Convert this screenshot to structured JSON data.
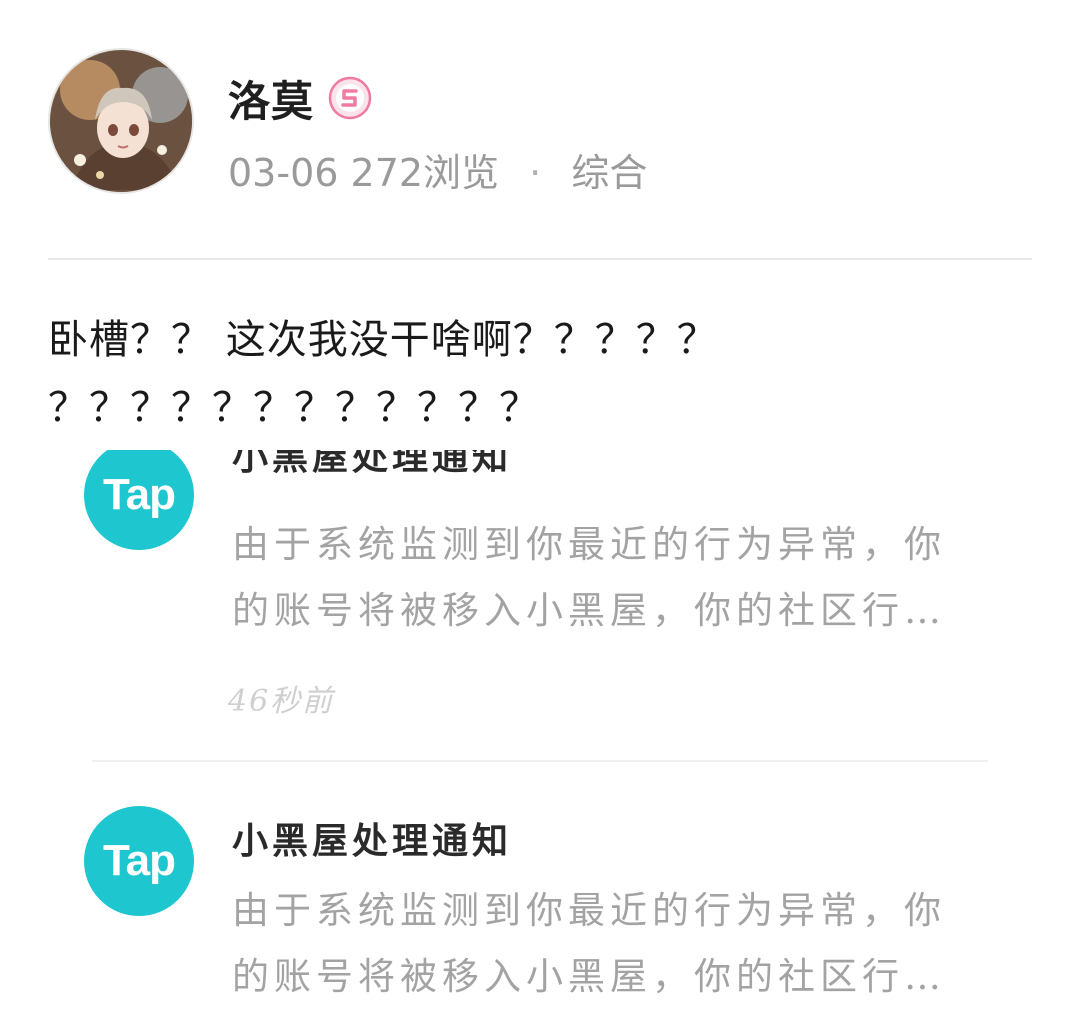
{
  "post": {
    "author": "洛莫",
    "date": "03-06",
    "views": "272浏览",
    "separator": "·",
    "category": "综合",
    "body_line1": "卧槽？？ 这次我没干啥啊？？？？？",
    "body_line2": "？？？？？？？？？？？？"
  },
  "notifications": [
    {
      "logo": "Tap",
      "title": "小黑屋处理通知",
      "line1": "由于系统监测到你最近的行为异常，你",
      "line2": "的账号将被移入小黑屋，你的社区行…",
      "time": "46秒前"
    },
    {
      "logo": "Tap",
      "title": "小黑屋处理通知",
      "line1": "由于系统监测到你最近的行为异常，你",
      "line2": "的账号将被移入小黑屋，你的社区行…"
    }
  ],
  "colors": {
    "tap_brand": "#1ec6cf",
    "badge_pink": "#f07aa0",
    "meta_gray": "#9a9a9a"
  },
  "icons": {
    "avatar": "user-avatar-illustration",
    "badge": "level-badge-icon"
  }
}
